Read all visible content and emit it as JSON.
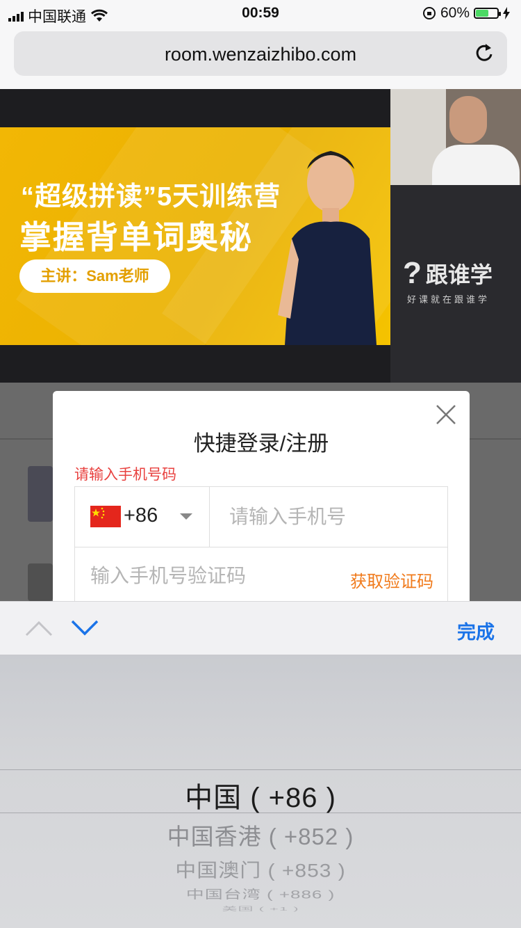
{
  "status_bar": {
    "carrier": "中国联通",
    "time": "00:59",
    "battery": "60%",
    "battery_level": 0.6,
    "battery_color": "#4cd964"
  },
  "address_bar": {
    "url": "room.wenzaizhibo.com",
    "reload_icon": "reload-icon"
  },
  "video": {
    "banner_line1": "“超级拼读”5天训练营",
    "banner_line2": "掌握背单词奥秘",
    "banner_pill": "主讲：Sam老师",
    "brand_name": "跟谁学",
    "brand_slogan": "好课就在跟谁学"
  },
  "login_modal": {
    "title": "快捷登录/注册",
    "error": "请输入手机号码",
    "country_code": "+86",
    "phone_placeholder": "请输入手机号",
    "code_placeholder": "输入手机号验证码",
    "get_code_label": "获取验证码",
    "error_color": "#e8413f",
    "accent_color": "#f07a1b"
  },
  "keyboard_accessory": {
    "done_label": "完成",
    "done_color": "#1a73e8"
  },
  "picker": {
    "options": [
      "中国 ( +86 )",
      "中国香港 ( +852 )",
      "中国澳门 ( +853 )",
      "中国台湾 ( +886 )",
      "美国 ( +1 )"
    ],
    "selected": "中国 ( +86 )"
  }
}
